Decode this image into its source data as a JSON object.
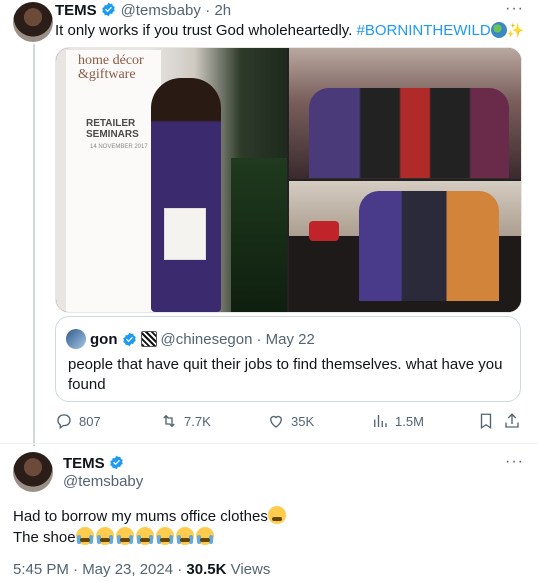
{
  "tweet1": {
    "name": "TEMS",
    "handle": "@temsbaby",
    "time": "· 2h",
    "text": "It only works if you trust God wholeheartedly. ",
    "hashtag": "#BORNINTHEWILD",
    "sparkle_char": "✨",
    "media": {
      "banner_line1": "home décor",
      "banner_line2": "&giftware",
      "banner_line3": "RETAILER",
      "banner_line4": "SEMINARS",
      "banner_date": "14 NOVEMBER 2017"
    },
    "quote": {
      "name": "gon",
      "handle": "@chinesegon",
      "date": "· May 22",
      "text": "people that have quit their jobs to find themselves. what have you found"
    },
    "actions": {
      "replies": "807",
      "reposts": "7.7K",
      "likes": "35K",
      "views": "1.5M"
    }
  },
  "tweet2": {
    "name": "TEMS",
    "handle": "@temsbaby",
    "line1": "Had to borrow my mums office clothes",
    "line2": "The shoe",
    "time": "5:45 PM · May 23, 2024 · ",
    "views_count": "30.5K",
    "views_label": " Views"
  },
  "more_glyph": "···",
  "colors": {
    "accent": "#1d9bf0",
    "secondary_text": "#536471",
    "border": "#cfd9de"
  }
}
